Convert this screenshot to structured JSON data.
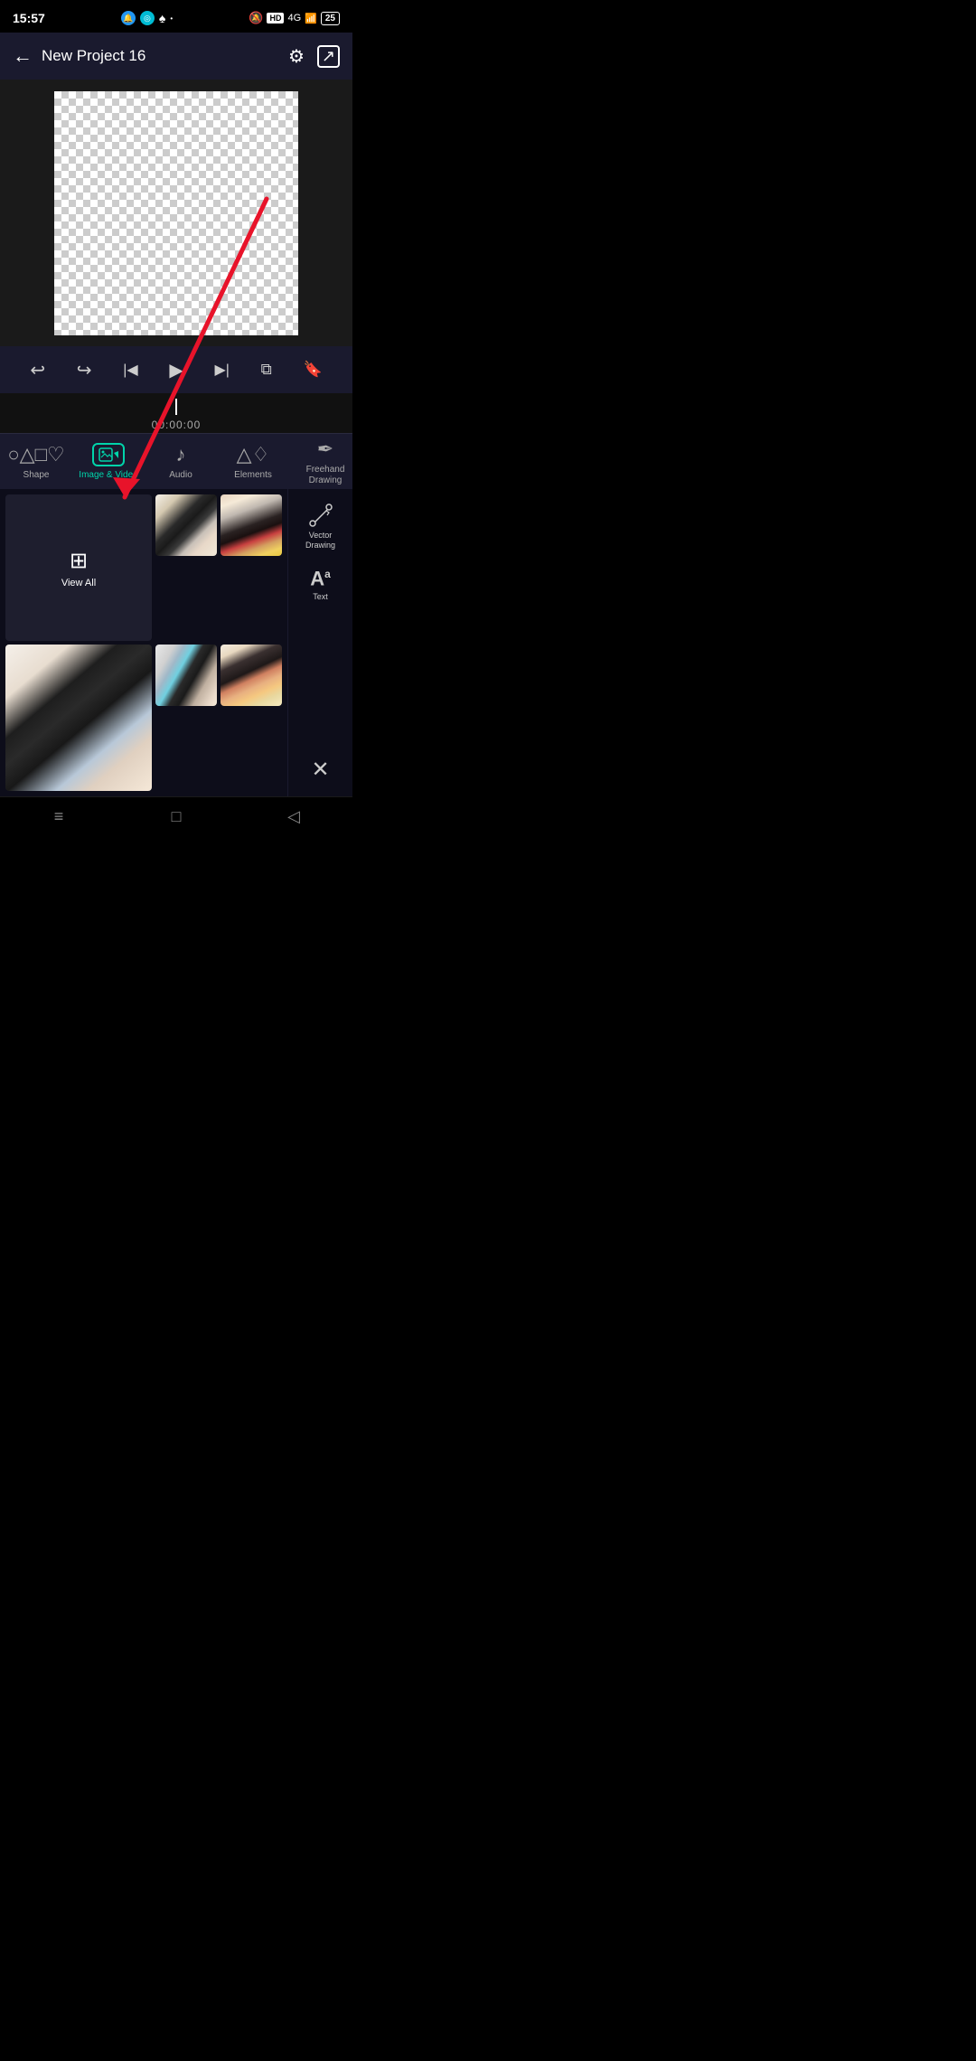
{
  "statusBar": {
    "time": "15:57",
    "batteryLevel": "25",
    "hdLabel": "HD",
    "signal": "4G"
  },
  "header": {
    "backLabel": "←",
    "title": "New Project 16",
    "settingsIcon": "⚙",
    "exportIcon": "⬡"
  },
  "canvas": {
    "altText": "Transparent canvas with checkerboard pattern"
  },
  "timelineControls": {
    "undoIcon": "↩",
    "redoIcon": "↪",
    "skipStartIcon": "|◀",
    "playIcon": "▶",
    "skipEndIcon": "▶|",
    "copyIcon": "⧉",
    "addIcon": "🔖"
  },
  "timeline": {
    "timeCode": "00:00:00"
  },
  "toolTabs": [
    {
      "id": "shape",
      "icon": "○△□♡",
      "label": "Shape",
      "active": false
    },
    {
      "id": "image-video",
      "icon": "🖼",
      "label": "Image & Video",
      "active": true
    },
    {
      "id": "audio",
      "icon": "♪",
      "label": "Audio",
      "active": false
    },
    {
      "id": "elements",
      "icon": "△♢",
      "label": "Elements",
      "active": false
    },
    {
      "id": "freehand",
      "icon": "✏",
      "label": "Freehand Drawing",
      "active": false
    }
  ],
  "mediaGrid": {
    "viewAllLabel": "View All",
    "items": [
      {
        "id": "view-all"
      },
      {
        "id": "thumb1",
        "type": "paint1"
      },
      {
        "id": "thumb2",
        "type": "paint2"
      },
      {
        "id": "thumb3",
        "type": "paint3"
      },
      {
        "id": "thumb4",
        "type": "paint4"
      },
      {
        "id": "thumb5",
        "type": "paint5"
      }
    ]
  },
  "rightSidebar": {
    "tools": [
      {
        "id": "vector-drawing",
        "icon": "✏",
        "label": "Vector Drawing"
      },
      {
        "id": "text",
        "icon": "Aᵃ",
        "label": "Text"
      }
    ],
    "closeIcon": "✕"
  },
  "navBar": {
    "menuIcon": "≡",
    "homeIcon": "□",
    "backIcon": "◁"
  },
  "redArrow": {
    "visible": true
  }
}
